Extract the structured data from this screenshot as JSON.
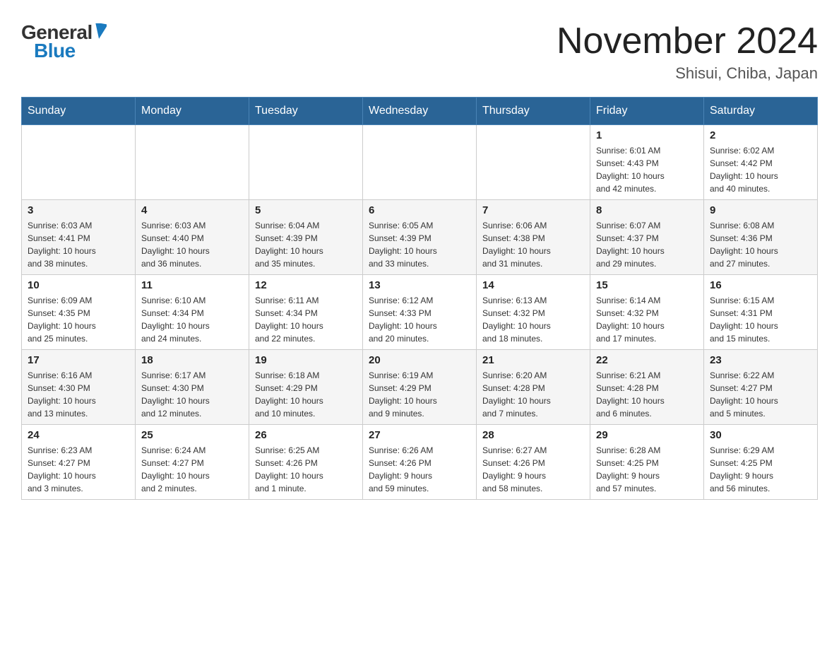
{
  "header": {
    "logo_general": "General",
    "logo_blue": "Blue",
    "month_title": "November 2024",
    "location": "Shisui, Chiba, Japan"
  },
  "weekdays": [
    "Sunday",
    "Monday",
    "Tuesday",
    "Wednesday",
    "Thursday",
    "Friday",
    "Saturday"
  ],
  "weeks": [
    [
      {
        "day": "",
        "info": ""
      },
      {
        "day": "",
        "info": ""
      },
      {
        "day": "",
        "info": ""
      },
      {
        "day": "",
        "info": ""
      },
      {
        "day": "",
        "info": ""
      },
      {
        "day": "1",
        "info": "Sunrise: 6:01 AM\nSunset: 4:43 PM\nDaylight: 10 hours\nand 42 minutes."
      },
      {
        "day": "2",
        "info": "Sunrise: 6:02 AM\nSunset: 4:42 PM\nDaylight: 10 hours\nand 40 minutes."
      }
    ],
    [
      {
        "day": "3",
        "info": "Sunrise: 6:03 AM\nSunset: 4:41 PM\nDaylight: 10 hours\nand 38 minutes."
      },
      {
        "day": "4",
        "info": "Sunrise: 6:03 AM\nSunset: 4:40 PM\nDaylight: 10 hours\nand 36 minutes."
      },
      {
        "day": "5",
        "info": "Sunrise: 6:04 AM\nSunset: 4:39 PM\nDaylight: 10 hours\nand 35 minutes."
      },
      {
        "day": "6",
        "info": "Sunrise: 6:05 AM\nSunset: 4:39 PM\nDaylight: 10 hours\nand 33 minutes."
      },
      {
        "day": "7",
        "info": "Sunrise: 6:06 AM\nSunset: 4:38 PM\nDaylight: 10 hours\nand 31 minutes."
      },
      {
        "day": "8",
        "info": "Sunrise: 6:07 AM\nSunset: 4:37 PM\nDaylight: 10 hours\nand 29 minutes."
      },
      {
        "day": "9",
        "info": "Sunrise: 6:08 AM\nSunset: 4:36 PM\nDaylight: 10 hours\nand 27 minutes."
      }
    ],
    [
      {
        "day": "10",
        "info": "Sunrise: 6:09 AM\nSunset: 4:35 PM\nDaylight: 10 hours\nand 25 minutes."
      },
      {
        "day": "11",
        "info": "Sunrise: 6:10 AM\nSunset: 4:34 PM\nDaylight: 10 hours\nand 24 minutes."
      },
      {
        "day": "12",
        "info": "Sunrise: 6:11 AM\nSunset: 4:34 PM\nDaylight: 10 hours\nand 22 minutes."
      },
      {
        "day": "13",
        "info": "Sunrise: 6:12 AM\nSunset: 4:33 PM\nDaylight: 10 hours\nand 20 minutes."
      },
      {
        "day": "14",
        "info": "Sunrise: 6:13 AM\nSunset: 4:32 PM\nDaylight: 10 hours\nand 18 minutes."
      },
      {
        "day": "15",
        "info": "Sunrise: 6:14 AM\nSunset: 4:32 PM\nDaylight: 10 hours\nand 17 minutes."
      },
      {
        "day": "16",
        "info": "Sunrise: 6:15 AM\nSunset: 4:31 PM\nDaylight: 10 hours\nand 15 minutes."
      }
    ],
    [
      {
        "day": "17",
        "info": "Sunrise: 6:16 AM\nSunset: 4:30 PM\nDaylight: 10 hours\nand 13 minutes."
      },
      {
        "day": "18",
        "info": "Sunrise: 6:17 AM\nSunset: 4:30 PM\nDaylight: 10 hours\nand 12 minutes."
      },
      {
        "day": "19",
        "info": "Sunrise: 6:18 AM\nSunset: 4:29 PM\nDaylight: 10 hours\nand 10 minutes."
      },
      {
        "day": "20",
        "info": "Sunrise: 6:19 AM\nSunset: 4:29 PM\nDaylight: 10 hours\nand 9 minutes."
      },
      {
        "day": "21",
        "info": "Sunrise: 6:20 AM\nSunset: 4:28 PM\nDaylight: 10 hours\nand 7 minutes."
      },
      {
        "day": "22",
        "info": "Sunrise: 6:21 AM\nSunset: 4:28 PM\nDaylight: 10 hours\nand 6 minutes."
      },
      {
        "day": "23",
        "info": "Sunrise: 6:22 AM\nSunset: 4:27 PM\nDaylight: 10 hours\nand 5 minutes."
      }
    ],
    [
      {
        "day": "24",
        "info": "Sunrise: 6:23 AM\nSunset: 4:27 PM\nDaylight: 10 hours\nand 3 minutes."
      },
      {
        "day": "25",
        "info": "Sunrise: 6:24 AM\nSunset: 4:27 PM\nDaylight: 10 hours\nand 2 minutes."
      },
      {
        "day": "26",
        "info": "Sunrise: 6:25 AM\nSunset: 4:26 PM\nDaylight: 10 hours\nand 1 minute."
      },
      {
        "day": "27",
        "info": "Sunrise: 6:26 AM\nSunset: 4:26 PM\nDaylight: 9 hours\nand 59 minutes."
      },
      {
        "day": "28",
        "info": "Sunrise: 6:27 AM\nSunset: 4:26 PM\nDaylight: 9 hours\nand 58 minutes."
      },
      {
        "day": "29",
        "info": "Sunrise: 6:28 AM\nSunset: 4:25 PM\nDaylight: 9 hours\nand 57 minutes."
      },
      {
        "day": "30",
        "info": "Sunrise: 6:29 AM\nSunset: 4:25 PM\nDaylight: 9 hours\nand 56 minutes."
      }
    ]
  ]
}
